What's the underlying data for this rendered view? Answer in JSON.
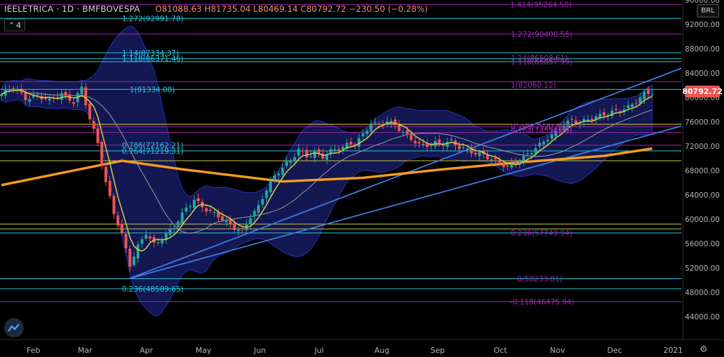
{
  "header": {
    "symbol": "IEELETRICA · 1D · BMFBOVESPA",
    "ohlc": "O81088.63  H81735.04  L80469.14  C80792.72  −230.50 (−0.28%)",
    "indicator_count": "4",
    "currency": "BRL"
  },
  "price_badge": "80792.72",
  "chart_data": {
    "type": "candlestick",
    "yaxis": {
      "min": 42000,
      "max": 96000,
      "ticks": [
        44000,
        48000,
        52000,
        56000,
        60000,
        64000,
        68000,
        72000,
        76000,
        80000,
        84000,
        88000,
        92000,
        96000
      ],
      "tick_labels": [
        "44000.00",
        "48000.00",
        "52000.00",
        "56000.00",
        "60000.00",
        "64000.00",
        "68000.00",
        "72000.00",
        "76000.00",
        "80000.00",
        "84000.00",
        "88000.00",
        "92000.00",
        "96000.00"
      ]
    },
    "xaxis": {
      "labels": [
        "Feb",
        "Mar",
        "Apr",
        "May",
        "Jun",
        "Jul",
        "Aug",
        "Sep",
        "Oct",
        "Nov",
        "Dec",
        "2021"
      ]
    },
    "price_points": [
      [
        0,
        80500
      ],
      [
        3,
        81800
      ],
      [
        6,
        79800
      ],
      [
        9,
        80300
      ],
      [
        12,
        79500
      ],
      [
        15,
        80600
      ],
      [
        18,
        79200
      ],
      [
        20,
        81600
      ],
      [
        22,
        76500
      ],
      [
        24,
        72500
      ],
      [
        26,
        66000
      ],
      [
        28,
        61000
      ],
      [
        30,
        57500
      ],
      [
        32,
        52500
      ],
      [
        34,
        55500
      ],
      [
        36,
        57800
      ],
      [
        38,
        55800
      ],
      [
        40,
        56800
      ],
      [
        43,
        58800
      ],
      [
        46,
        61800
      ],
      [
        48,
        63200
      ],
      [
        50,
        62000
      ],
      [
        52,
        61200
      ],
      [
        54,
        60500
      ],
      [
        56,
        59600
      ],
      [
        58,
        58600
      ],
      [
        60,
        58000
      ],
      [
        62,
        60500
      ],
      [
        64,
        62000
      ],
      [
        66,
        65000
      ],
      [
        68,
        67000
      ],
      [
        70,
        68600
      ],
      [
        72,
        69600
      ],
      [
        74,
        71500
      ],
      [
        76,
        70300
      ],
      [
        78,
        71000
      ],
      [
        80,
        70200
      ],
      [
        82,
        71200
      ],
      [
        84,
        71600
      ],
      [
        86,
        72200
      ],
      [
        88,
        72500
      ],
      [
        90,
        73800
      ],
      [
        92,
        75800
      ],
      [
        94,
        75500
      ],
      [
        96,
        76100
      ],
      [
        98,
        75500
      ],
      [
        100,
        74200
      ],
      [
        102,
        73200
      ],
      [
        104,
        72200
      ],
      [
        106,
        72200
      ],
      [
        108,
        72500
      ],
      [
        110,
        72400
      ],
      [
        112,
        72800
      ],
      [
        114,
        71800
      ],
      [
        116,
        71400
      ],
      [
        118,
        70800
      ],
      [
        120,
        70600
      ],
      [
        122,
        69800
      ],
      [
        124,
        69200
      ],
      [
        126,
        68600
      ],
      [
        128,
        69400
      ],
      [
        130,
        70100
      ],
      [
        132,
        71200
      ],
      [
        134,
        72200
      ],
      [
        136,
        73400
      ],
      [
        138,
        74200
      ],
      [
        140,
        75600
      ],
      [
        142,
        76200
      ],
      [
        144,
        75800
      ],
      [
        146,
        76400
      ],
      [
        148,
        76800
      ],
      [
        150,
        77200
      ],
      [
        152,
        77600
      ],
      [
        154,
        77900
      ],
      [
        156,
        78400
      ],
      [
        158,
        79300
      ],
      [
        160,
        80600
      ],
      [
        162,
        80800
      ]
    ],
    "hline_levels": [
      95264.5,
      92991.78,
      90400,
      87334.37,
      86371.46,
      85857.99,
      82600,
      81334.08,
      75200,
      74250,
      72162.21,
      71219.31,
      69600,
      59200,
      58400,
      57749.94,
      50233.81,
      48589.65,
      46475.94
    ],
    "fib_labels": [
      {
        "text": "1.414(95264.50)",
        "price": 95264.5,
        "color": "#9c27b0"
      },
      {
        "text": "1.272(92991.78)",
        "price": 92991.78,
        "color": "#26c6da"
      },
      {
        "text": "1.272(90400.55)",
        "price": 90400,
        "color": "#9c27b0"
      },
      {
        "text": "1.14(87334.37)",
        "price": 87334.37,
        "color": "#26c6da"
      },
      {
        "text": "1.118(86371.46)",
        "price": 86371.46,
        "color": "#26c6da"
      },
      {
        "text": "1.14(86508.61)",
        "price": 86508.61,
        "color": "#9c27b0"
      },
      {
        "text": "1.118(85857.99)",
        "price": 85857.99,
        "color": "#9c27b0"
      },
      {
        "text": "1(81334.08)",
        "price": 81334.08,
        "color": "#26c6da"
      },
      {
        "text": "1(82060.12)",
        "price": 82060.12,
        "color": "#9c27b0"
      },
      {
        "text": "0.786(75202.04)",
        "price": 75202.04,
        "color": "#9c27b0"
      },
      {
        "text": "0.764(74598.49)",
        "price": 74598.49,
        "color": "#9c27b0"
      },
      {
        "text": "0.786(72162.21)",
        "price": 72162.21,
        "color": "#26c6da"
      },
      {
        "text": "0.764(71219.31)",
        "price": 71219.31,
        "color": "#26c6da"
      },
      {
        "text": "0.236(57749.94)",
        "price": 57749.94,
        "color": "#9c27b0"
      },
      {
        "text": "0(50233.81)",
        "price": 50233.81,
        "color": "#9c27b0"
      },
      {
        "text": "0.236(48589.65)",
        "price": 48589.65,
        "color": "#26c6da"
      },
      {
        "text": "-0.118(46475.94)",
        "price": 46475.94,
        "color": "#9c27b0"
      }
    ],
    "colors": {
      "up": "#26a69a",
      "down": "#ef5350",
      "cyan": "#26c6da",
      "purple": "#9c27b0",
      "yellow": "#c9c74a",
      "orange": "#f59b21",
      "trend": "#3f7be0",
      "band": "#1a1f6e"
    }
  }
}
